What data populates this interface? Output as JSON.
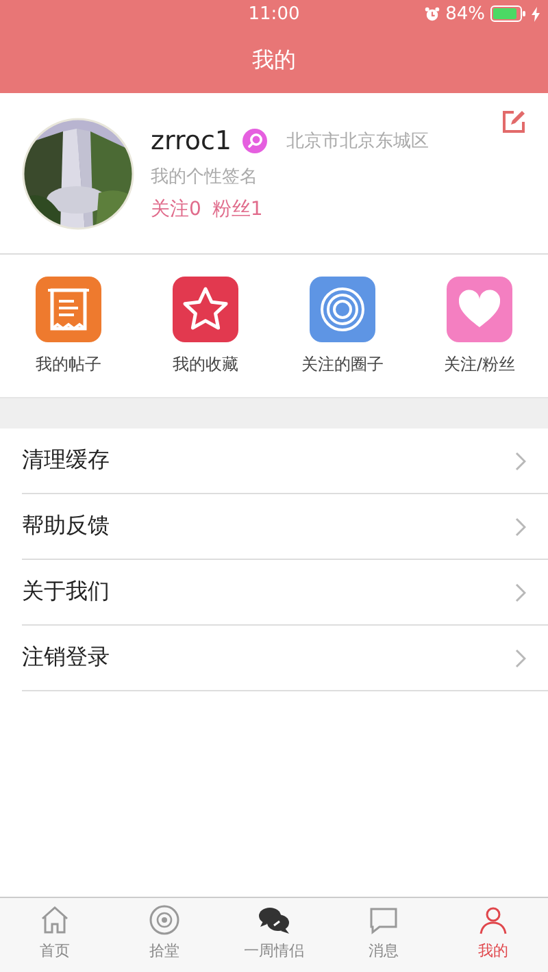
{
  "status_bar": {
    "time": "11:00",
    "battery": "84%"
  },
  "nav_bar": {
    "title": "我的"
  },
  "profile": {
    "username": "zrroc1",
    "location": "北京市北京东城区",
    "signature": "我的个性签名",
    "following": "关注0",
    "followers": "粉丝1"
  },
  "shortcuts": [
    {
      "kind": "posts",
      "label": "我的帖子",
      "color": "#ee7a2e"
    },
    {
      "kind": "favorites",
      "label": "我的收藏",
      "color": "#e2394f"
    },
    {
      "kind": "circles",
      "label": "关注的圈子",
      "color": "#5e95e4"
    },
    {
      "kind": "fans",
      "label": "关注/粉丝",
      "color": "#f47fc1"
    }
  ],
  "menu": [
    {
      "label": "清理缓存"
    },
    {
      "label": "帮助反馈"
    },
    {
      "label": "关于我们"
    },
    {
      "label": "注销登录"
    }
  ],
  "tab_bar": [
    {
      "kind": "home",
      "label": "首页",
      "selected": false
    },
    {
      "kind": "disc",
      "label": "拾堂",
      "selected": false
    },
    {
      "kind": "chat",
      "label": "一周情侣",
      "selected": false
    },
    {
      "kind": "message",
      "label": "消息",
      "selected": false
    },
    {
      "kind": "me",
      "label": "我的",
      "selected": true
    }
  ]
}
